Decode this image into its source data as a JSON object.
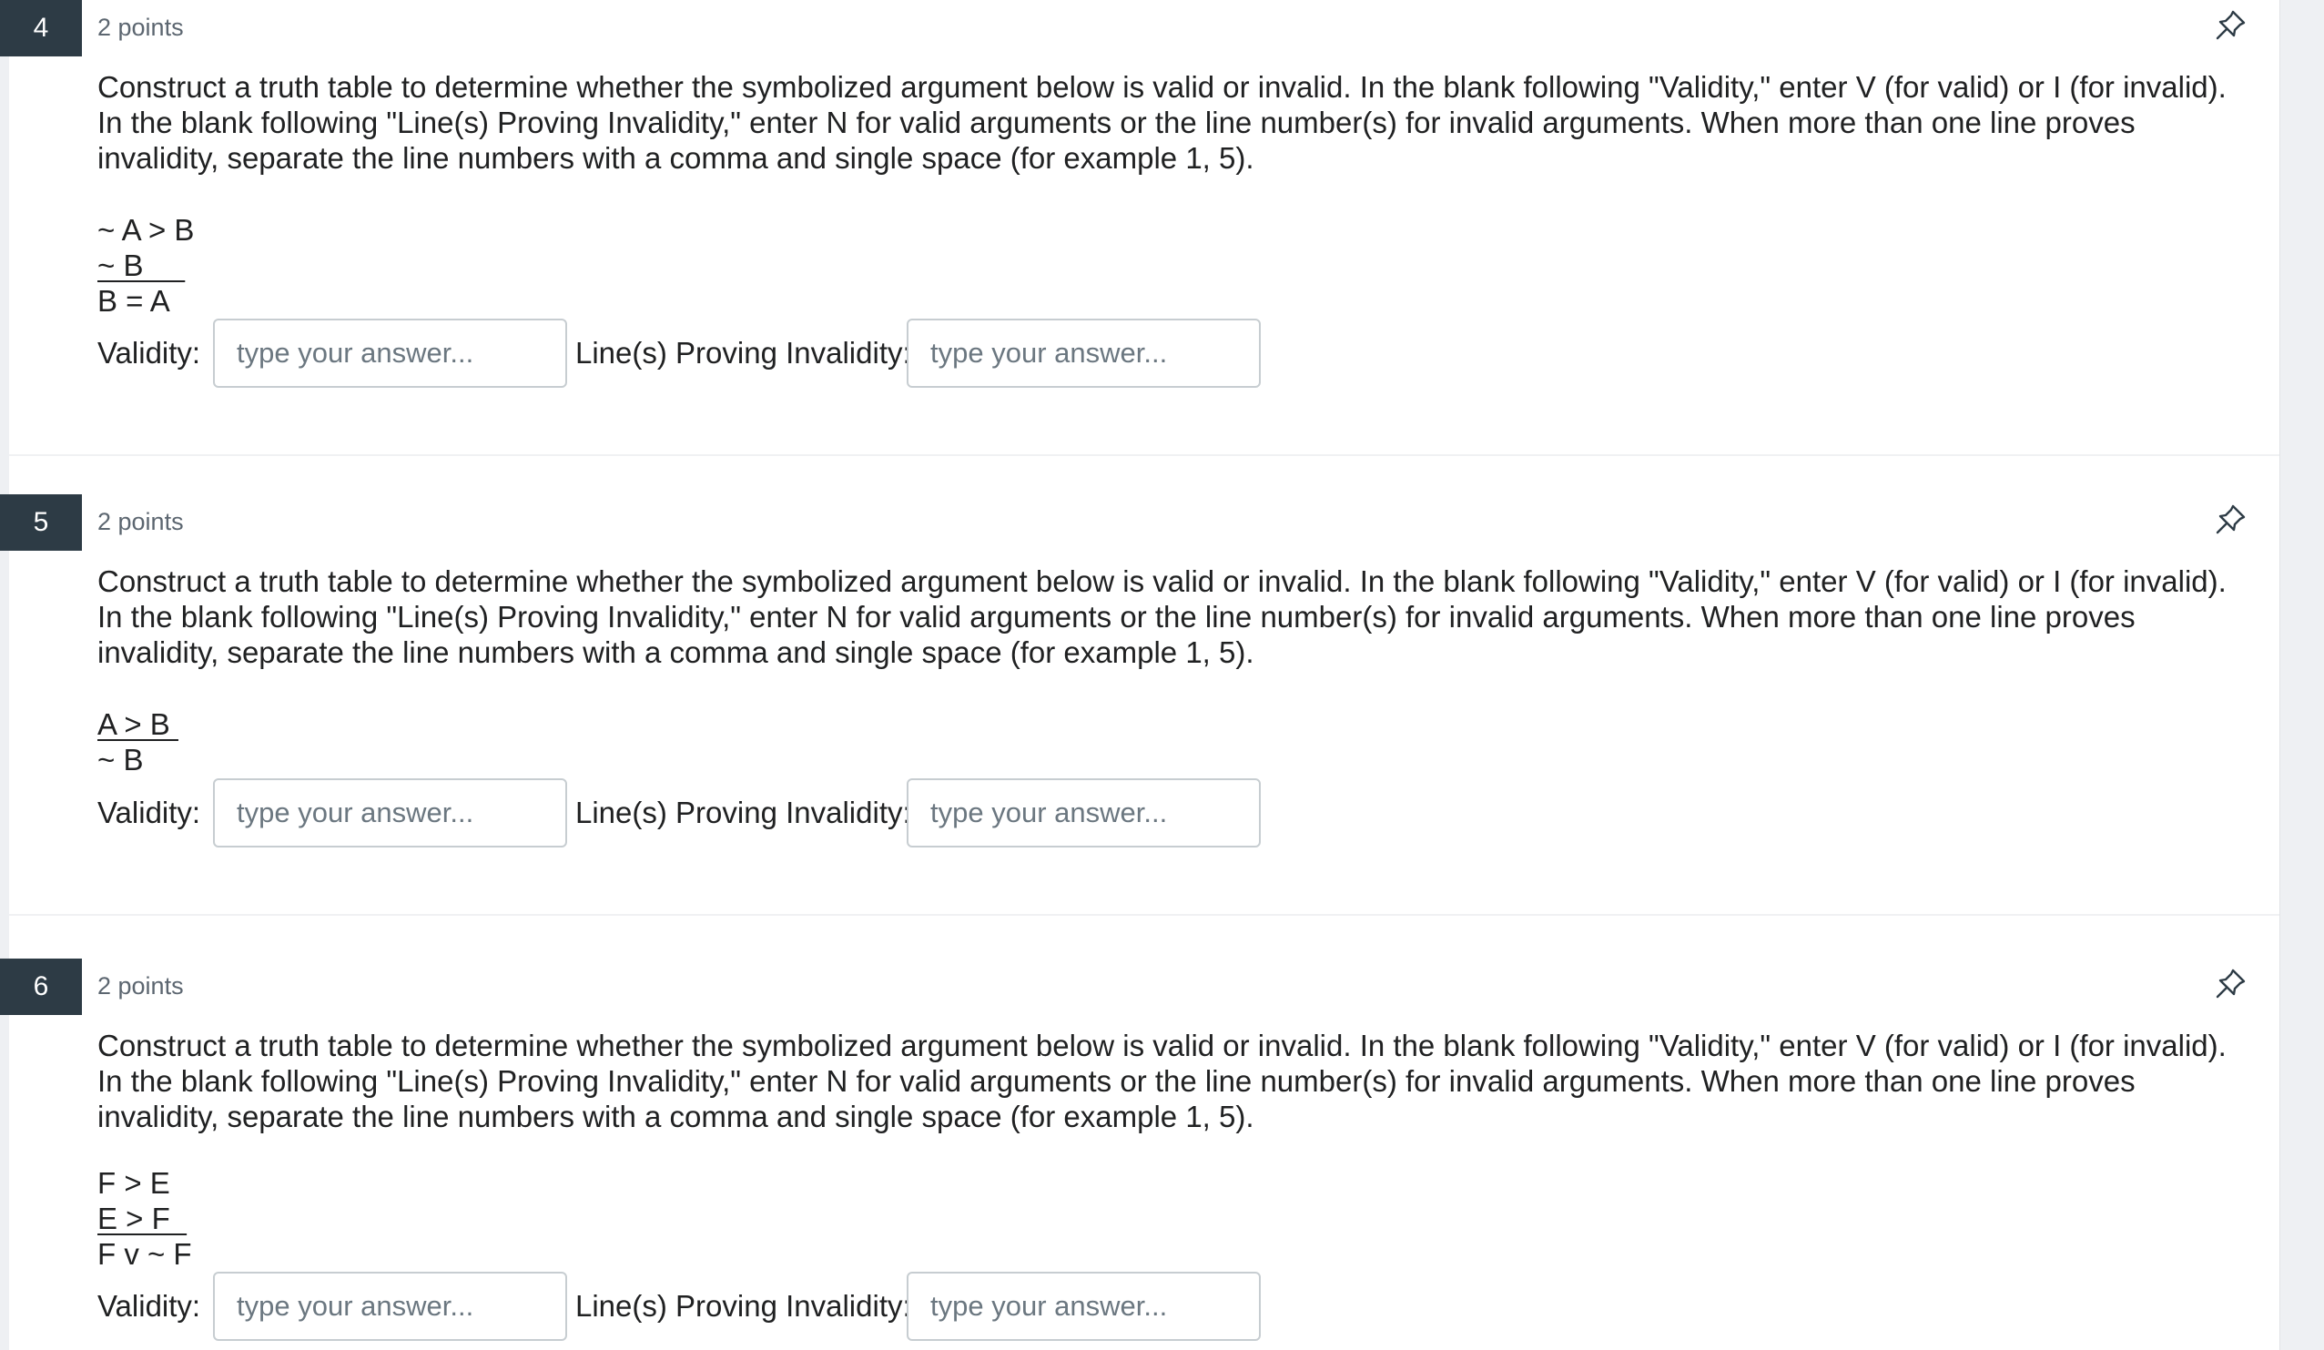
{
  "questions": [
    {
      "number": "4",
      "points": "2 points",
      "prompt": "Construct a truth table to determine whether the symbolized argument below is valid or invalid. In the blank following \"Validity,\" enter V (for valid) or I (for invalid). In the blank following \"Line(s) Proving Invalidity,\" enter N for valid arguments or the line number(s) for invalid arguments. When more than one line proves invalidity, separate the line numbers with a comma and single space (for example 1, 5).",
      "argument": [
        "~ A > B",
        "~ B     ",
        "B = A"
      ],
      "validity_label": "Validity:",
      "validity_placeholder": "type your answer...",
      "invalidity_label": "Line(s) Proving Invalidity:",
      "invalidity_placeholder": "type your answer..."
    },
    {
      "number": "5",
      "points": "2 points",
      "prompt": "Construct a truth table to determine whether the symbolized argument below is valid or invalid. In the blank following \"Validity,\" enter V (for valid) or I (for invalid). In the blank following \"Line(s) Proving Invalidity,\" enter N for valid arguments or the line number(s) for invalid arguments. When more than one line proves invalidity, separate the line numbers with a comma and single space (for example 1, 5).",
      "argument": [
        "A > B ",
        "~ B"
      ],
      "validity_label": "Validity:",
      "validity_placeholder": "type your answer...",
      "invalidity_label": "Line(s) Proving Invalidity:",
      "invalidity_placeholder": "type your answer..."
    },
    {
      "number": "6",
      "points": "2 points",
      "prompt": "Construct a truth table to determine whether the symbolized argument below is valid or invalid. In the blank following \"Validity,\" enter V (for valid) or I (for invalid). In the blank following \"Line(s) Proving Invalidity,\" enter N for valid arguments or the line number(s) for invalid arguments. When more than one line proves invalidity, separate the line numbers with a comma and single space (for example 1, 5).",
      "argument": [
        "F > E",
        "E > F  ",
        "F v ~ F"
      ],
      "validity_label": "Validity:",
      "validity_placeholder": "type your answer...",
      "invalidity_label": "Line(s) Proving Invalidity:",
      "invalidity_placeholder": "type your answer..."
    }
  ],
  "icons": {
    "pin": "pin-icon"
  },
  "colors": {
    "question_number_bg": "#2d3b45",
    "input_border": "#c7cdd1",
    "points_text": "#5c6670"
  }
}
